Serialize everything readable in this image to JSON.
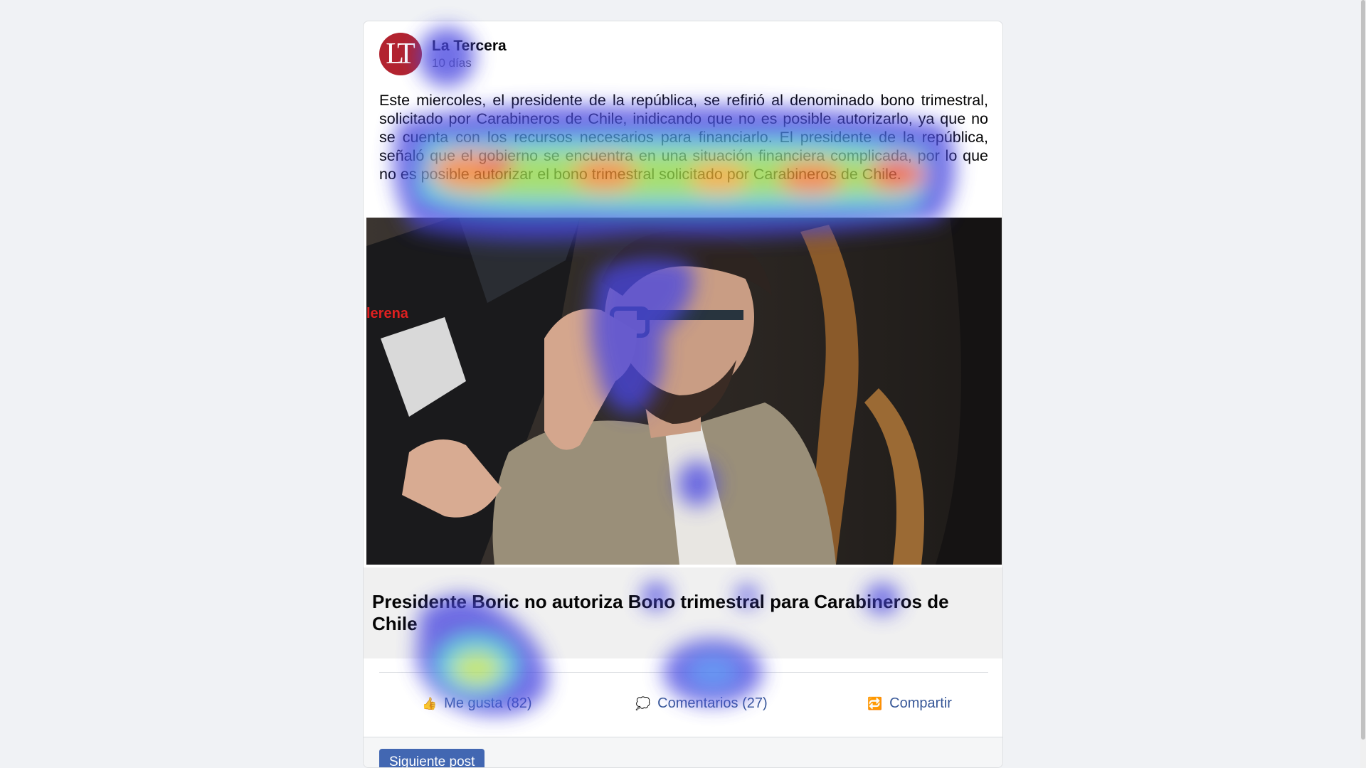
{
  "post": {
    "author": "La Tercera",
    "avatar_text": "LT",
    "time": "10 días",
    "body": "Este miercoles, el presidente de la república, se refirió al denominado bono trimestral, solicitado por Carabineros de Chile, inidicando que no es posible autorizarlo, ya que no se cuenta con los recursos necesarios para financiarlo. El presidente de la república, señaló que el gobierno se encuentra en una situación financiera complicada, por lo que no es posible autorizar el bono trimestral solicitado por Carabineros de Chile.",
    "photo_overlay_text": "lerena",
    "link_title": "Presidente Boric no autoriza Bono trimestral para Carabineros de Chile"
  },
  "actions": {
    "like_label": "Me gusta (82)",
    "like_icon": "thumbs-up-icon",
    "comment_label": "Comentarios (27)",
    "comment_icon": "speech-bubble-icon",
    "share_label": "Compartir",
    "share_icon": "share-icon"
  },
  "footer": {
    "next_label": "Siguiente post"
  },
  "colors": {
    "avatar": "#b2232f",
    "link": "#385898",
    "button": "#4267b2",
    "page_bg": "#f0f2f5"
  }
}
